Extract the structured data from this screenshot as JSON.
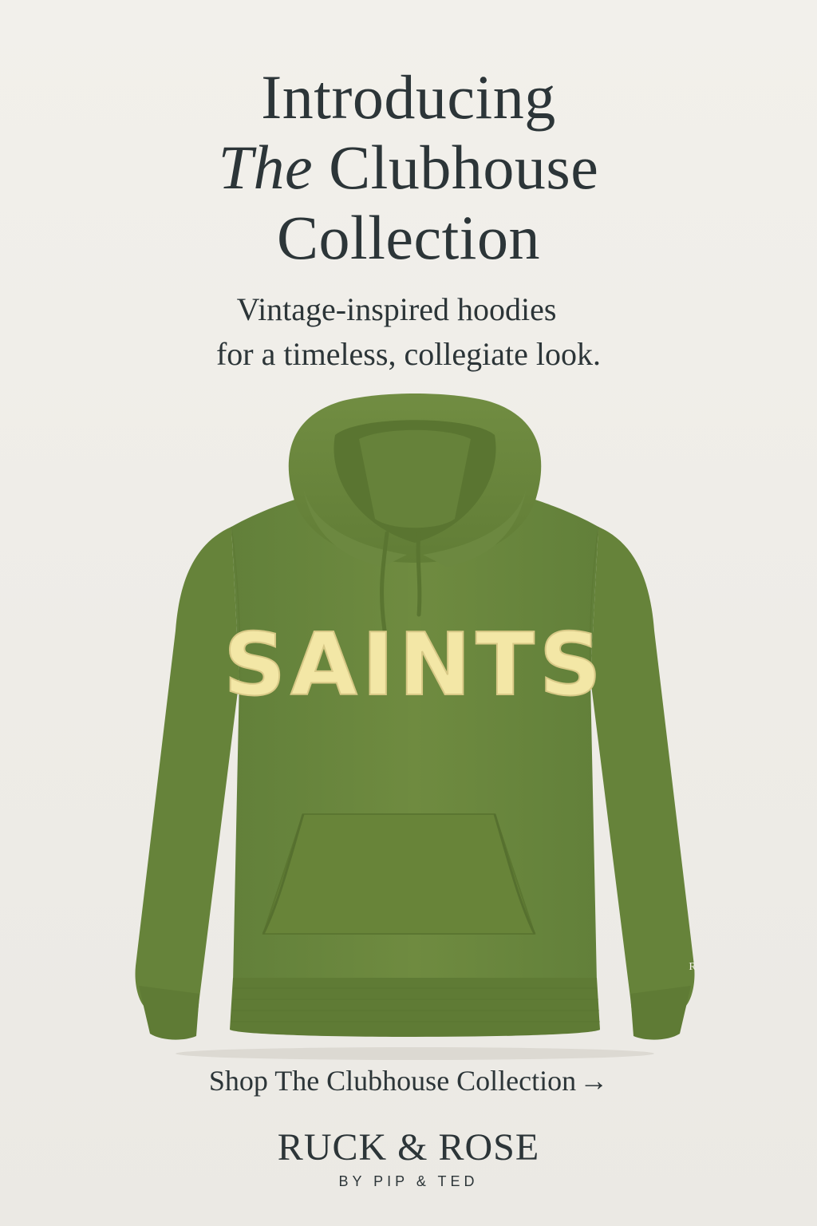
{
  "headline": {
    "line1": "Introducing",
    "line2_italic": "The",
    "line2_rest": " Clubhouse",
    "line3": "Collection"
  },
  "subhead": {
    "line1": "Vintage-inspired hoodies",
    "line2": "for a timeless, collegiate look."
  },
  "product": {
    "chest_text": "SAINTS",
    "cuff_mark": "R",
    "colors": {
      "body": "#6e8a3e",
      "shadow": "#5c7632",
      "highlight": "#7c9848",
      "lettering": "#f3e7a6"
    }
  },
  "cta": {
    "label": "Shop The Clubhouse Collection",
    "arrow": "→"
  },
  "brand": {
    "name": "RUCK & ROSE",
    "sub": "BY PIP & TED"
  }
}
